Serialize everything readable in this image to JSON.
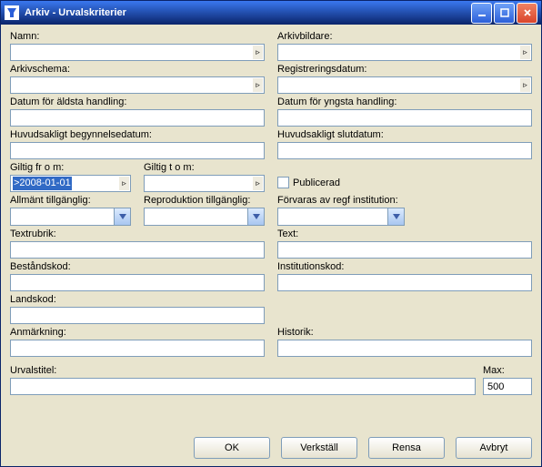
{
  "title": "Arkiv - Urvalskriterier",
  "labels": {
    "namn": "Namn:",
    "arkivbildare": "Arkivbildare:",
    "arkivschema": "Arkivschema:",
    "registreringsdatum": "Registreringsdatum:",
    "aldsta": "Datum för äldsta handling:",
    "yngsta": "Datum för yngsta handling:",
    "begynnelse": "Huvudsakligt begynnelsedatum:",
    "slutdatum": "Huvudsakligt slutdatum:",
    "giltigfrom": "Giltig fr o m:",
    "giltigtom": "Giltig t o m:",
    "publicerad": "Publicerad",
    "allmant": "Allmänt tillgänglig:",
    "reproduktion": "Reproduktion tillgänglig:",
    "forvaras": "Förvaras av regf institution:",
    "textrubrik": "Textrubrik:",
    "text": "Text:",
    "bestandskod": "Beståndskod:",
    "institutionskod": "Institutionskod:",
    "landskod": "Landskod:",
    "anmarkning": "Anmärkning:",
    "historik": "Historik:",
    "urvalstitel": "Urvalstitel:",
    "max": "Max:"
  },
  "values": {
    "giltigfrom": ">2008-01-01",
    "max": "500"
  },
  "buttons": {
    "ok": "OK",
    "verkstall": "Verkställ",
    "rensa": "Rensa",
    "avbryt": "Avbryt"
  }
}
